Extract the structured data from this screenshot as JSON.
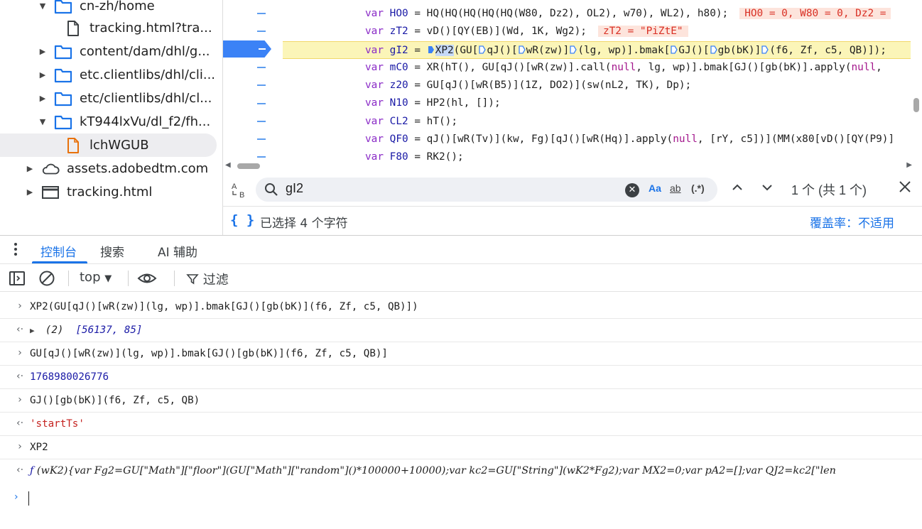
{
  "tree": {
    "items": [
      {
        "label": "cn-zh/home",
        "arrow": "▼",
        "icon": "folder-icon",
        "depth": 3
      },
      {
        "label": "tracking.html?tra...",
        "arrow": "",
        "icon": "file-icon",
        "depth": 4
      },
      {
        "label": "content/dam/dhl/g...",
        "arrow": "▶",
        "icon": "folder-icon",
        "depth": 3
      },
      {
        "label": "etc.clientlibs/dhl/cli...",
        "arrow": "▶",
        "icon": "folder-icon",
        "depth": 3
      },
      {
        "label": "etc/clientlibs/dhl/cl...",
        "arrow": "▶",
        "icon": "folder-icon",
        "depth": 3
      },
      {
        "label": "kT944lxVu/dl_f2/fh...",
        "arrow": "▼",
        "icon": "folder-icon",
        "depth": 3
      },
      {
        "label": "lchWGUB",
        "arrow": "",
        "icon": "script-file-icon",
        "depth": 4,
        "selected": true
      },
      {
        "label": "assets.adobedtm.com",
        "arrow": "▶",
        "icon": "cloud-icon",
        "depth": 2
      },
      {
        "label": "tracking.html",
        "arrow": "▶",
        "icon": "frame-icon",
        "depth": 2
      }
    ]
  },
  "editor": {
    "lines": [
      {
        "var": "var",
        "name": "HO0",
        "rest": " = HQ(HQ(HQ(HQ(HQ(W80, Dz2), OL2), w70), WL2), h80);",
        "inline": "HO0 = 0, W80 = 0, Dz2 ="
      },
      {
        "var": "var",
        "name": "zT2",
        "rest": " = vD()[QY(EB)](Wd, 1K, Wg2);",
        "inline": "zT2 = \"PiZtE\""
      },
      {
        "var": "var",
        "name": "gI2",
        "rest": "",
        "exec": true
      },
      {
        "var": "var",
        "name": "mC0",
        "rest": " = XR(hT(), GU[qJ()[wR(zw)].call(",
        "nul": "null",
        "rest2": ", lg, wp)].bmak[GJ()[gb(bK)].apply(",
        "nul2": "null",
        "rest3": ","
      },
      {
        "var": "var",
        "name": "z20",
        "rest": " = GU[qJ()[wR(B5)](1Z, DO2)](sw(nL2, TK), Dp);"
      },
      {
        "var": "var",
        "name": "N10",
        "rest": " = HP2(hl, []);"
      },
      {
        "var": "var",
        "name": "CL2",
        "rest": " = hT();"
      },
      {
        "var": "var",
        "name": "QF0",
        "rest": " = qJ()[wR(Tv)](kw, Fg)[qJ()[wR(Hq)].apply(",
        "nul": "null",
        "rest2": ", [rY, c5])](MM(x80[vD()[QY(P9)]"
      },
      {
        "var": "var",
        "name": "F80",
        "rest": " = RK2();"
      }
    ],
    "exec_parts": [
      " = ",
      "XP2",
      "(GU[",
      "qJ()[",
      "wR(zw)]",
      "(lg, wp)].bmak[",
      "GJ()[",
      "gb(bK)]",
      "(f6, Zf, c5, QB)]);"
    ]
  },
  "search": {
    "case_label": "A B",
    "query": "gI2",
    "match_case": "Aa",
    "whole_word": "ab",
    "regex": "(.*)",
    "match_count": "1 个 (共 1 个)"
  },
  "status": {
    "braces": "{ }",
    "selection": "已选择 4 个字符",
    "coverage": "覆盖率：不适用"
  },
  "drawer": {
    "tabs": [
      "控制台",
      "搜索",
      "AI 辅助"
    ]
  },
  "console_toolbar": {
    "context": "top",
    "filter": "过滤"
  },
  "console": {
    "messages": [
      {
        "type": "input",
        "prefix": "›",
        "text": "XP2(GU[qJ()[wR(zw)](lg, wp)].bmak[GJ()[gb(bK)](f6, Zf, c5, QB)])"
      },
      {
        "type": "array",
        "prefix": "‹·",
        "count": "(2)",
        "values": "[56137, 85]"
      },
      {
        "type": "input",
        "prefix": "›",
        "text": "GU[qJ()[wR(zw)](lg, wp)].bmak[GJ()[gb(bK)](f6, Zf, c5, QB)]"
      },
      {
        "type": "number",
        "prefix": "‹·",
        "text": "1768980026776"
      },
      {
        "type": "input",
        "prefix": "›",
        "text": "GJ()[gb(bK)](f6, Zf, c5, QB)"
      },
      {
        "type": "string",
        "prefix": "‹·",
        "text": "'startTs'"
      },
      {
        "type": "input",
        "prefix": "›",
        "text": "XP2"
      },
      {
        "type": "function",
        "prefix": "‹·",
        "f": "ƒ",
        "text": " (wK2){var Fg2=GU[\"Math\"][\"floor\"](GU[\"Math\"][\"random\"]()*100000+10000);var kc2=GU[\"String\"](wK2*Fg2);var MX2=0;var pA2=[];var QJ2=kc2[\"len"
      }
    ],
    "prompt": "›"
  },
  "colors": {
    "accent": "#1a73e8",
    "exec_line": "#fbf5b8",
    "breakpoint": "#3b82f6",
    "string": "#c5221f",
    "keyword": "#8a2bc7"
  }
}
